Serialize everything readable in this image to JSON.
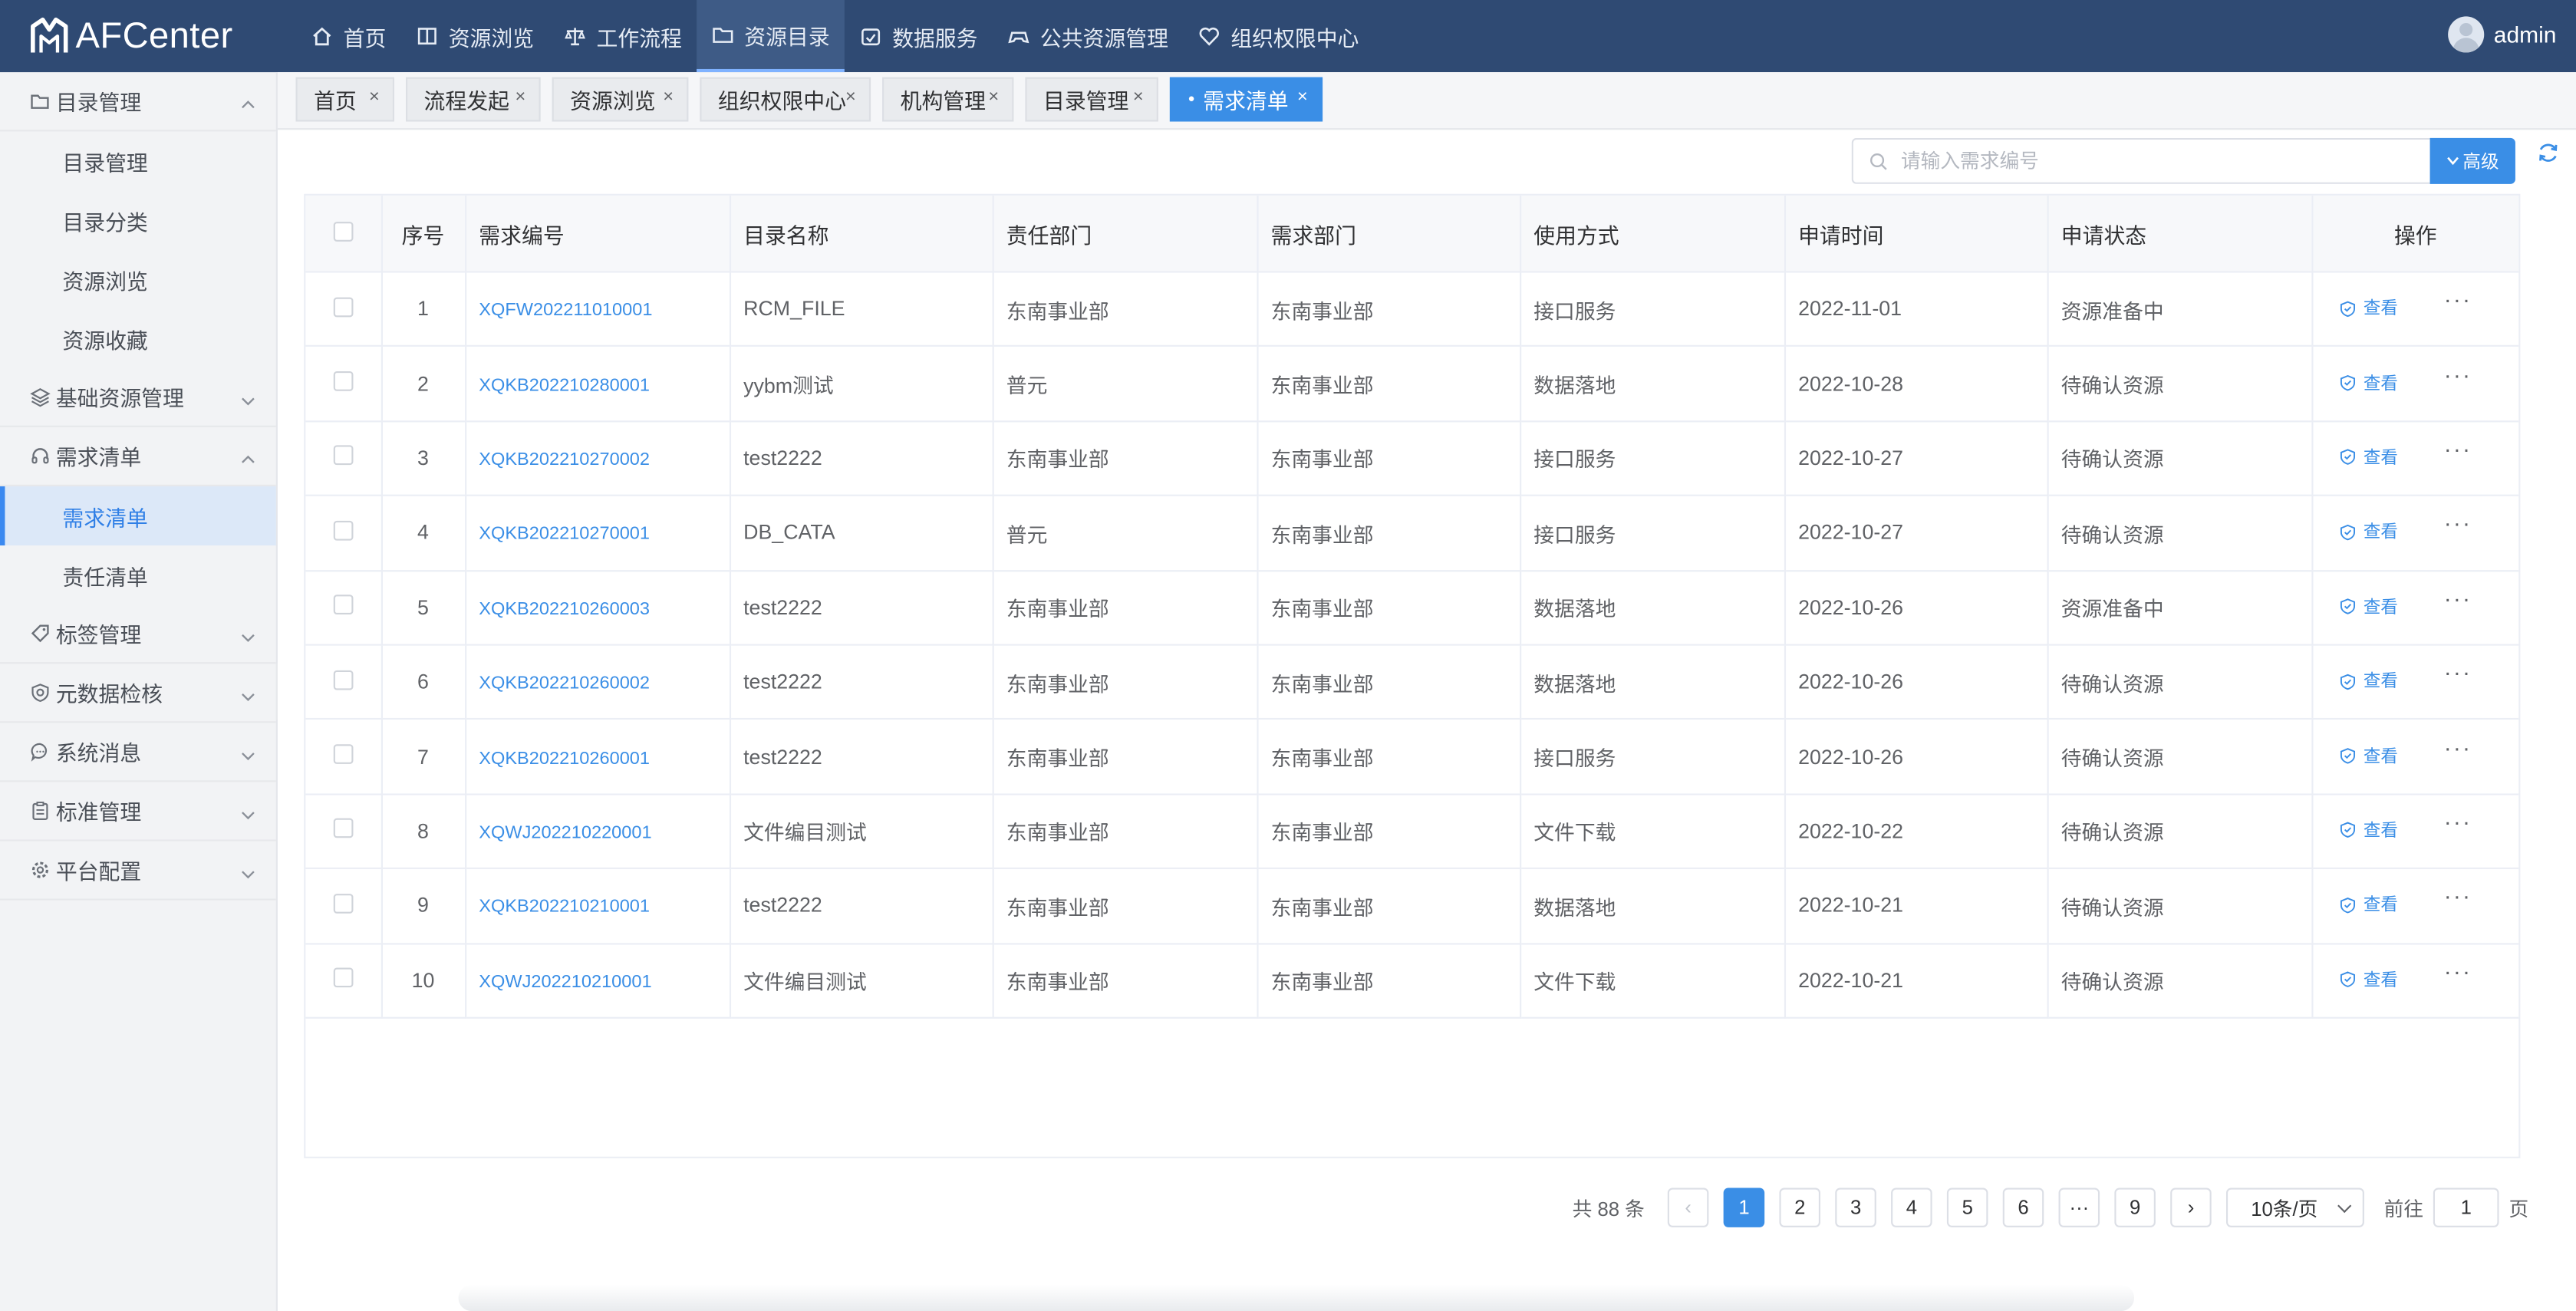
{
  "app": {
    "name": "AFCenter"
  },
  "topnav": [
    {
      "label": "首页",
      "icon": "home-icon"
    },
    {
      "label": "资源浏览",
      "icon": "book-icon"
    },
    {
      "label": "工作流程",
      "icon": "scale-icon"
    },
    {
      "label": "资源目录",
      "icon": "folder-icon",
      "active": true
    },
    {
      "label": "数据服务",
      "icon": "calendar-icon"
    },
    {
      "label": "公共资源管理",
      "icon": "gamepad-icon"
    },
    {
      "label": "组织权限中心",
      "icon": "heart-shield-icon"
    }
  ],
  "user": {
    "name": "admin"
  },
  "sidebar": {
    "groups": [
      {
        "label": "目录管理",
        "icon": "folder-icon",
        "expanded": true,
        "items": [
          "目录管理",
          "目录分类",
          "资源浏览",
          "资源收藏"
        ]
      },
      {
        "label": "基础资源管理",
        "icon": "layers-icon",
        "expanded": false,
        "items": []
      },
      {
        "label": "需求清单",
        "icon": "headset-icon",
        "expanded": true,
        "items": [
          "需求清单",
          "责任清单"
        ],
        "active_item": "需求清单"
      },
      {
        "label": "标签管理",
        "icon": "tag-icon",
        "expanded": false,
        "items": []
      },
      {
        "label": "元数据检核",
        "icon": "shield-check-icon",
        "expanded": false,
        "items": []
      },
      {
        "label": "系统消息",
        "icon": "chat-icon",
        "expanded": false,
        "items": []
      },
      {
        "label": "标准管理",
        "icon": "clipboard-icon",
        "expanded": false,
        "items": []
      },
      {
        "label": "平台配置",
        "icon": "gear-icon",
        "expanded": false,
        "items": []
      }
    ]
  },
  "tabs": [
    {
      "label": "首页"
    },
    {
      "label": "流程发起"
    },
    {
      "label": "资源浏览"
    },
    {
      "label": "组织权限中心"
    },
    {
      "label": "机构管理"
    },
    {
      "label": "目录管理"
    },
    {
      "label": "需求清单",
      "active": true
    }
  ],
  "tab_active_dot": "●",
  "tab_close": "×",
  "search": {
    "placeholder": "请输入需求编号",
    "advanced_label": "高级"
  },
  "table": {
    "headers": [
      "序号",
      "需求编号",
      "目录名称",
      "责任部门",
      "需求部门",
      "使用方式",
      "申请时间",
      "申请状态",
      "操作"
    ],
    "view_label": "查看",
    "more_label": "···",
    "rows": [
      {
        "no": "1",
        "id": "XQFW202211010001",
        "catalog": "RCM_FILE",
        "resp": "东南事业部",
        "req": "东南事业部",
        "method": "接口服务",
        "time": "2022-11-01",
        "status": "资源准备中"
      },
      {
        "no": "2",
        "id": "XQKB202210280001",
        "catalog": "yybm测试",
        "resp": "普元",
        "req": "东南事业部",
        "method": "数据落地",
        "time": "2022-10-28",
        "status": "待确认资源"
      },
      {
        "no": "3",
        "id": "XQKB202210270002",
        "catalog": "test2222",
        "resp": "东南事业部",
        "req": "东南事业部",
        "method": "接口服务",
        "time": "2022-10-27",
        "status": "待确认资源"
      },
      {
        "no": "4",
        "id": "XQKB202210270001",
        "catalog": "DB_CATA",
        "resp": "普元",
        "req": "东南事业部",
        "method": "接口服务",
        "time": "2022-10-27",
        "status": "待确认资源"
      },
      {
        "no": "5",
        "id": "XQKB202210260003",
        "catalog": "test2222",
        "resp": "东南事业部",
        "req": "东南事业部",
        "method": "数据落地",
        "time": "2022-10-26",
        "status": "资源准备中"
      },
      {
        "no": "6",
        "id": "XQKB202210260002",
        "catalog": "test2222",
        "resp": "东南事业部",
        "req": "东南事业部",
        "method": "数据落地",
        "time": "2022-10-26",
        "status": "待确认资源"
      },
      {
        "no": "7",
        "id": "XQKB202210260001",
        "catalog": "test2222",
        "resp": "东南事业部",
        "req": "东南事业部",
        "method": "接口服务",
        "time": "2022-10-26",
        "status": "待确认资源"
      },
      {
        "no": "8",
        "id": "XQWJ202210220001",
        "catalog": "文件编目测试",
        "resp": "东南事业部",
        "req": "东南事业部",
        "method": "文件下载",
        "time": "2022-10-22",
        "status": "待确认资源"
      },
      {
        "no": "9",
        "id": "XQKB202210210001",
        "catalog": "test2222",
        "resp": "东南事业部",
        "req": "东南事业部",
        "method": "数据落地",
        "time": "2022-10-21",
        "status": "待确认资源"
      },
      {
        "no": "10",
        "id": "XQWJ202210210001",
        "catalog": "文件编目测试",
        "resp": "东南事业部",
        "req": "东南事业部",
        "method": "文件下载",
        "time": "2022-10-21",
        "status": "待确认资源"
      }
    ]
  },
  "pagination": {
    "total_label": "共 88 条",
    "prev": "‹",
    "next": "›",
    "pages": [
      "1",
      "2",
      "3",
      "4",
      "5",
      "6",
      "···",
      "9"
    ],
    "current": "1",
    "page_size": "10条/页",
    "goto_label": "前往",
    "goto_value": "1",
    "page_suffix": "页"
  },
  "colors": {
    "topbar": "#2f4a73",
    "accent": "#3a8ee6",
    "sidebar_active_bg": "#dce8f8"
  }
}
